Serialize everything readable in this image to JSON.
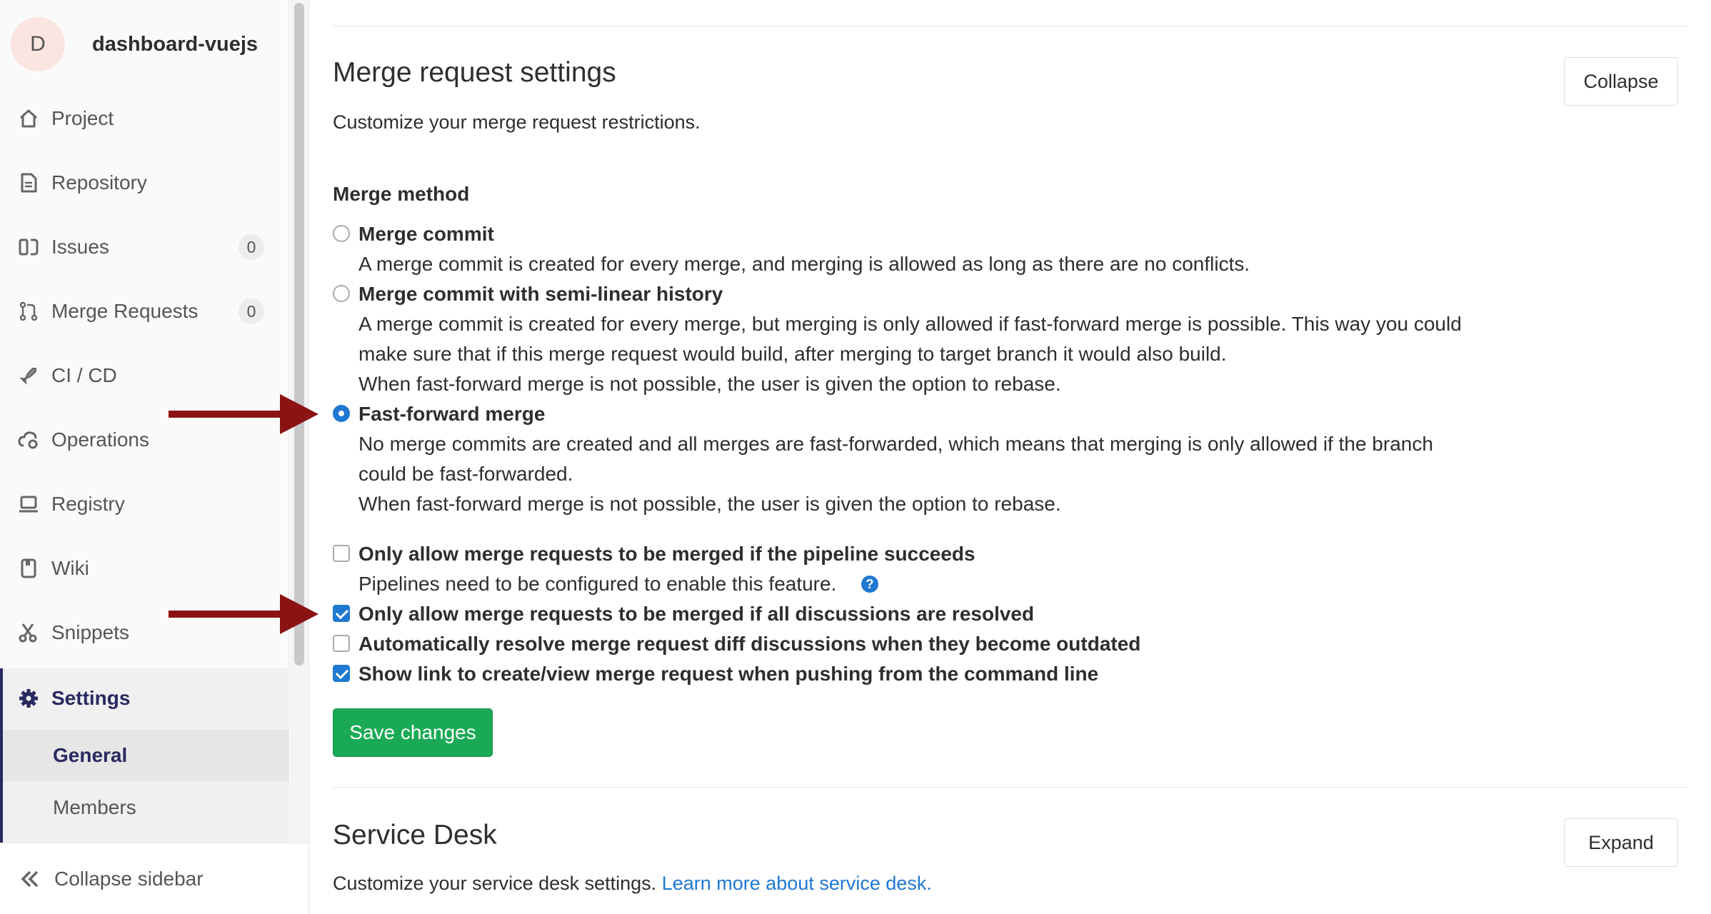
{
  "sidebar": {
    "project": {
      "avatar_letter": "D",
      "name": "dashboard-vuejs"
    },
    "items": [
      {
        "label": "Project",
        "icon": "home-icon"
      },
      {
        "label": "Repository",
        "icon": "doc-icon"
      },
      {
        "label": "Issues",
        "icon": "issues-icon",
        "badge": "0"
      },
      {
        "label": "Merge Requests",
        "icon": "merge-request-icon",
        "badge": "0"
      },
      {
        "label": "CI / CD",
        "icon": "rocket-icon"
      },
      {
        "label": "Operations",
        "icon": "cloud-gear-icon"
      },
      {
        "label": "Registry",
        "icon": "laptop-icon"
      },
      {
        "label": "Wiki",
        "icon": "book-icon"
      },
      {
        "label": "Snippets",
        "icon": "scissors-icon"
      },
      {
        "label": "Settings",
        "icon": "gear-icon",
        "active": true
      }
    ],
    "subitems": [
      {
        "label": "General",
        "active": true
      },
      {
        "label": "Members"
      }
    ],
    "collapse_label": "Collapse sidebar"
  },
  "merge_settings": {
    "title": "Merge request settings",
    "description": "Customize your merge request restrictions.",
    "collapse_button": "Collapse",
    "merge_method_label": "Merge method",
    "methods": [
      {
        "label": "Merge commit",
        "selected": false,
        "help": [
          "A merge commit is created for every merge, and merging is allowed as long as there are no conflicts."
        ]
      },
      {
        "label": "Merge commit with semi-linear history",
        "selected": false,
        "help": [
          "A merge commit is created for every merge, but merging is only allowed if fast-forward merge is possible. This way you could",
          "make sure that if this merge request would build, after merging to target branch it would also build.",
          "When fast-forward merge is not possible, the user is given the option to rebase."
        ]
      },
      {
        "label": "Fast-forward merge",
        "selected": true,
        "help": [
          "No merge commits are created and all merges are fast-forwarded, which means that merging is only allowed if the branch",
          "could be fast-forwarded.",
          "When fast-forward merge is not possible, the user is given the option to rebase."
        ]
      }
    ],
    "options": [
      {
        "label": "Only allow merge requests to be merged if the pipeline succeeds",
        "checked": false,
        "help": "Pipelines need to be configured to enable this feature."
      },
      {
        "label": "Only allow merge requests to be merged if all discussions are resolved",
        "checked": true
      },
      {
        "label": "Automatically resolve merge request diff discussions when they become outdated",
        "checked": false
      },
      {
        "label": "Show link to create/view merge request when pushing from the command line",
        "checked": true
      }
    ],
    "help_icon_glyph": "?",
    "save_button": "Save changes"
  },
  "service_desk": {
    "title": "Service Desk",
    "description": "Customize your service desk settings.",
    "link_text": "Learn more about service desk.",
    "expand_button": "Expand"
  },
  "colors": {
    "accent": "#1f78d1",
    "save_green": "#1aaa55",
    "arrow": "#8b1313",
    "sidebar_active": "#292961"
  }
}
